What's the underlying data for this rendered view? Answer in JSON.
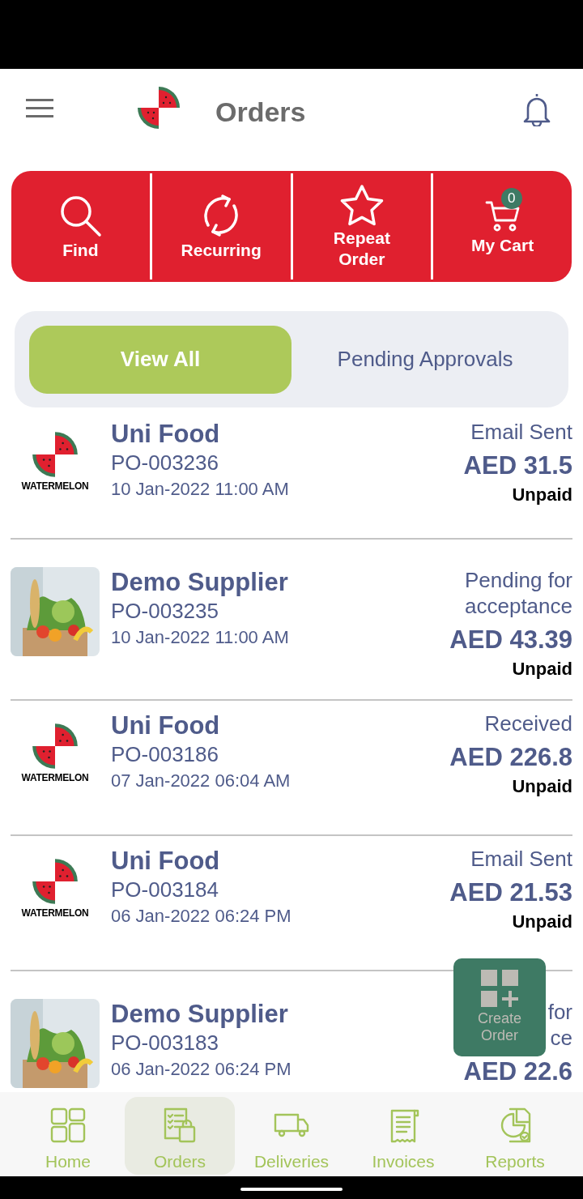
{
  "header": {
    "title": "Orders"
  },
  "actions": [
    {
      "kind": "find",
      "label": "Find"
    },
    {
      "kind": "recurring",
      "label": "Recurring"
    },
    {
      "kind": "repeat",
      "label": "Repeat Order"
    },
    {
      "kind": "cart",
      "label": "My Cart",
      "badge": "0"
    }
  ],
  "tabs": [
    {
      "label": "View All",
      "selected": true
    },
    {
      "label": "Pending Approvals",
      "selected": false
    }
  ],
  "orders": [
    {
      "kind": "logo",
      "brand": "WATERMELON",
      "supplier": "Uni Food",
      "po": "PO-003236",
      "date": "10 Jan-2022 11:00 AM",
      "status_lines": [
        "Email Sent"
      ],
      "amount": "AED 31.5",
      "payment": "Unpaid"
    },
    {
      "kind": "picture",
      "supplier": "Demo Supplier",
      "po": "PO-003235",
      "date": "10 Jan-2022 11:00 AM",
      "status_lines": [
        "Pending for",
        "acceptance"
      ],
      "amount": "AED 43.39",
      "payment": "Unpaid"
    },
    {
      "kind": "logo",
      "brand": "WATERMELON",
      "supplier": "Uni Food",
      "po": "PO-003186",
      "date": "07 Jan-2022 06:04 AM",
      "status_lines": [
        "Received"
      ],
      "amount": "AED 226.8",
      "payment": "Unpaid"
    },
    {
      "kind": "logo",
      "brand": "WATERMELON",
      "supplier": "Uni Food",
      "po": "PO-003184",
      "date": "06 Jan-2022 06:24 PM",
      "status_lines": [
        "Email Sent"
      ],
      "amount": "AED 21.53",
      "payment": "Unpaid"
    },
    {
      "kind": "picture",
      "supplier": "Demo Supplier",
      "po": "PO-003183",
      "date": "06 Jan-2022 06:24 PM",
      "status_lines": [
        "for",
        "ce"
      ],
      "amount": "AED 22.6"
    }
  ],
  "fab": {
    "label": "Create Order"
  },
  "nav": [
    {
      "kind": "home",
      "label": "Home",
      "selected": false
    },
    {
      "kind": "orders",
      "label": "Orders",
      "selected": true
    },
    {
      "kind": "deliveries",
      "label": "Deliveries",
      "selected": false
    },
    {
      "kind": "invoices",
      "label": "Invoices",
      "selected": false
    },
    {
      "kind": "reports",
      "label": "Reports",
      "selected": false
    }
  ]
}
